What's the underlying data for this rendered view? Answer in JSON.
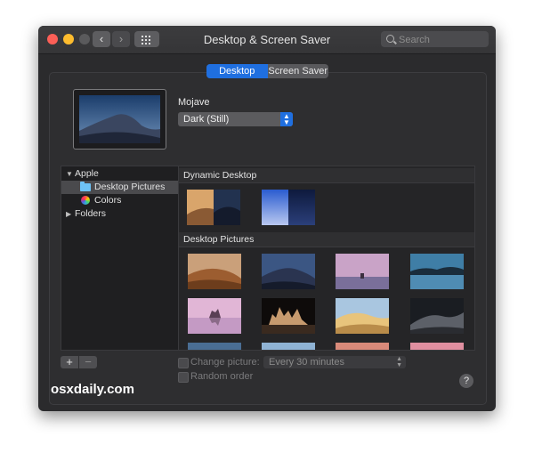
{
  "window": {
    "title": "Desktop & Screen Saver",
    "search_placeholder": "Search"
  },
  "tabs": [
    {
      "label": "Desktop",
      "active": true
    },
    {
      "label": "Screen Saver",
      "active": false
    }
  ],
  "wallpaper": {
    "name": "Mojave",
    "mode": "Dark (Still)"
  },
  "sidebar": {
    "items": [
      {
        "label": "Apple",
        "type": "group",
        "expanded": true
      },
      {
        "label": "Desktop Pictures",
        "type": "folder",
        "selected": true
      },
      {
        "label": "Colors",
        "type": "colors"
      },
      {
        "label": "Folders",
        "type": "group",
        "expanded": false
      }
    ]
  },
  "sections": {
    "dynamic": "Dynamic Desktop",
    "pictures": "Desktop Pictures"
  },
  "options": {
    "change_picture_label": "Change picture:",
    "interval": "Every 30 minutes",
    "random_order_label": "Random order"
  },
  "controls": {
    "add": "+",
    "remove": "−",
    "help": "?"
  },
  "watermark": "osxdaily.com",
  "colors": {
    "accent": "#1f6fe0",
    "close": "#fc5f57",
    "minimize": "#fdbc2e"
  }
}
